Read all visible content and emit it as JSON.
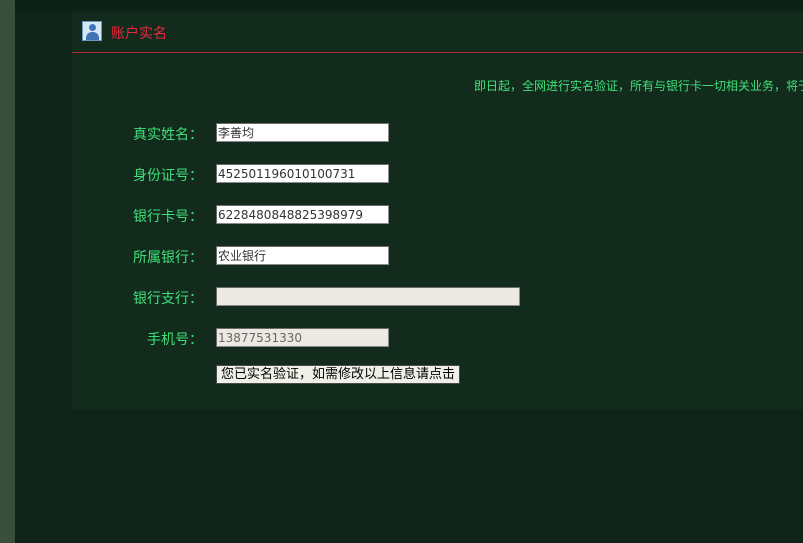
{
  "panel": {
    "title": "账户实名",
    "notice": "即日起，全网进行实名验证，所有与银行卡一切相关业务，将于"
  },
  "form": {
    "fields": [
      {
        "label": "真实姓名：",
        "value": "李善均"
      },
      {
        "label": "身份证号：",
        "value": "452501196010100731"
      },
      {
        "label": "银行卡号：",
        "value": "6228480848825398979"
      },
      {
        "label": "所属银行：",
        "value": "农业银行"
      },
      {
        "label": "银行支行：",
        "value": ""
      },
      {
        "label": "手机号：",
        "value": "13877531330"
      }
    ],
    "submit_label": "您已实名验证，如需修改以上信息请点击"
  },
  "icons": {
    "header": "user-icon"
  },
  "colors": {
    "background": "#0e2418",
    "panel": "#122b1c",
    "title": "#e8283e",
    "label": "#3fe07a",
    "divider": "#b5283a"
  }
}
